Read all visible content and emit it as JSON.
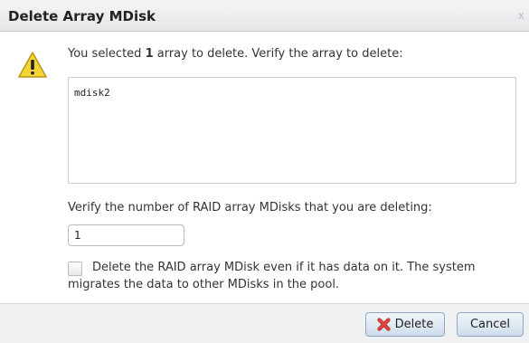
{
  "dialog": {
    "title": "Delete Array MDisk",
    "close_glyph": "x"
  },
  "warning_icon": "warning-triangle-icon",
  "message": {
    "prefix": "You selected ",
    "count": "1",
    "suffix": " array to delete. Verify the array to delete:"
  },
  "arrays": [
    "mdisk2"
  ],
  "verify": {
    "label": "Verify the number of RAID array MDisks that you are deleting:",
    "value": "1"
  },
  "force_delete": {
    "checked": false,
    "line1": "Delete the RAID array MDisk even if it has data on it. The system",
    "line2": "migrates the data to other MDisks in the pool."
  },
  "buttons": {
    "delete_label": "Delete",
    "delete_icon": "red-x-icon",
    "cancel_label": "Cancel"
  },
  "colors": {
    "title_bar": "#e4e6e8",
    "button_border": "#8fa9c4",
    "warning_yellow": "#f5d437",
    "delete_icon_red": "#e0453b"
  }
}
